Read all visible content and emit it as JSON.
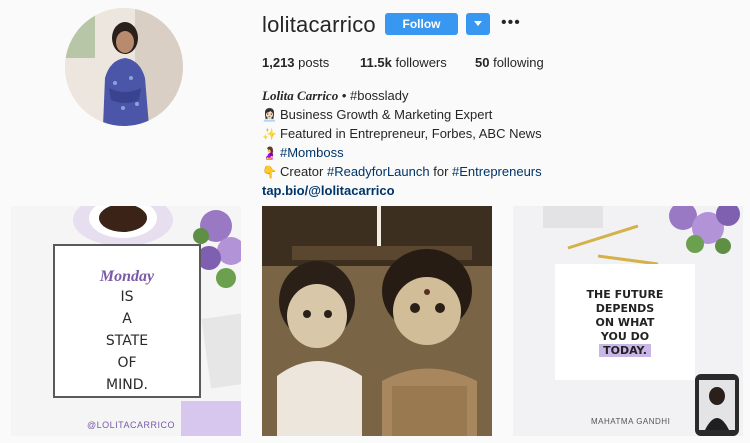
{
  "profile": {
    "username": "lolitacarrico",
    "follow_label": "Follow",
    "more_icon": "•••"
  },
  "stats": {
    "posts_count": "1,213",
    "posts_label": "posts",
    "followers_count": "11.5k",
    "followers_label": "followers",
    "following_count": "50",
    "following_label": "following"
  },
  "bio": {
    "name": "Lolita Carrico",
    "name_suffix": " • #bosslady",
    "line1_icon": "👩🏻‍💼",
    "line1": "Business Growth & Marketing Expert",
    "line2_icon": "✨",
    "line2": "Featured in Entrepreneur, Forbes, ABC News",
    "line3_icon": "🤰",
    "line3_tag": "#Momboss",
    "line4_icon": "👇",
    "line4_prefix": "Creator ",
    "line4_tag1": "#ReadyforLaunch",
    "line4_mid": " for ",
    "line4_tag2": "#Entrepreneurs",
    "link": "tap.bio/@lolitacarrico"
  },
  "posts": {
    "post1": {
      "script_word": "Monday",
      "line1": "IS",
      "line2": "A",
      "line3": "STATE",
      "line4": "OF",
      "line5": "MIND.",
      "handle": "@LOLITACARRICO"
    },
    "post3": {
      "line1": "THE FUTURE",
      "line2": "DEPENDS",
      "line3": "ON WHAT",
      "line4": "YOU DO",
      "line5": "TODAY.",
      "author": "MAHATMA GANDHI"
    }
  },
  "colors": {
    "follow_blue": "#3897f0",
    "link_blue": "#003569",
    "accent_purple": "#7a5aa6"
  }
}
